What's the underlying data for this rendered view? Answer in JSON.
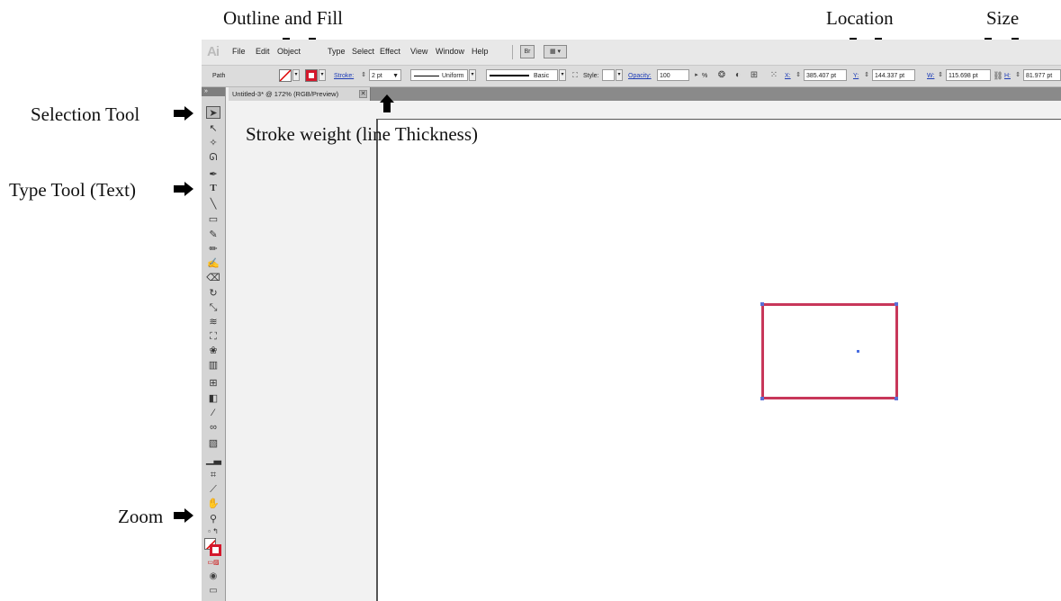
{
  "annotations": {
    "outline_fill": "Outline and Fill",
    "location": "Location",
    "size": "Size",
    "selection_tool": "Selection Tool",
    "type_tool": "Type Tool (Text)",
    "zoom": "Zoom",
    "stroke_weight": "Stroke weight (line Thickness)"
  },
  "app": {
    "logo": "Ai",
    "menu": [
      "File",
      "Edit",
      "Object",
      "Type",
      "Select",
      "Effect",
      "View",
      "Window",
      "Help"
    ],
    "menu_buttons": [
      "Br",
      "▦ ▾"
    ]
  },
  "control_bar": {
    "selection_label": "Path",
    "stroke_link": "Stroke:",
    "stroke_weight_value": "2 pt",
    "profile_value": "Uniform",
    "brush_value": "Basic",
    "style_label": "Style:",
    "opacity_link": "Opacity:",
    "opacity_value": "100",
    "opacity_unit": "%",
    "x_label": "X:",
    "x_value": "385.407 pt",
    "y_label": "Y:",
    "y_value": "144.337 pt",
    "w_label": "W:",
    "w_value": "115.698 pt",
    "h_label": "H:",
    "h_value": "81.977 pt"
  },
  "document": {
    "tab_title": "Untitled-3* @ 172% (RGB/Preview)",
    "tab_close": "✕"
  },
  "toolbar": {
    "grip": "»",
    "tools": [
      "selection-tool",
      "direct-selection-tool",
      "magic-wand-tool",
      "lasso-tool",
      "pen-tool",
      "type-tool",
      "line-tool",
      "rectangle-tool",
      "paintbrush-tool",
      "pencil-tool",
      "blob-brush-tool",
      "eraser-tool",
      "rotate-tool",
      "scale-tool",
      "warp-tool",
      "free-transform-tool",
      "symbol-sprayer-tool",
      "graph-tool",
      "mesh-tool",
      "gradient-tool",
      "eyedropper-tool",
      "blend-tool",
      "live-paint-tool",
      "column-graph-tool",
      "artboard-tool",
      "slice-tool",
      "hand-tool",
      "zoom-tool"
    ]
  },
  "colors": {
    "stroke_color": "#c8375a",
    "selection_color": "#4a6ee0",
    "link_color": "#1e3db6"
  }
}
